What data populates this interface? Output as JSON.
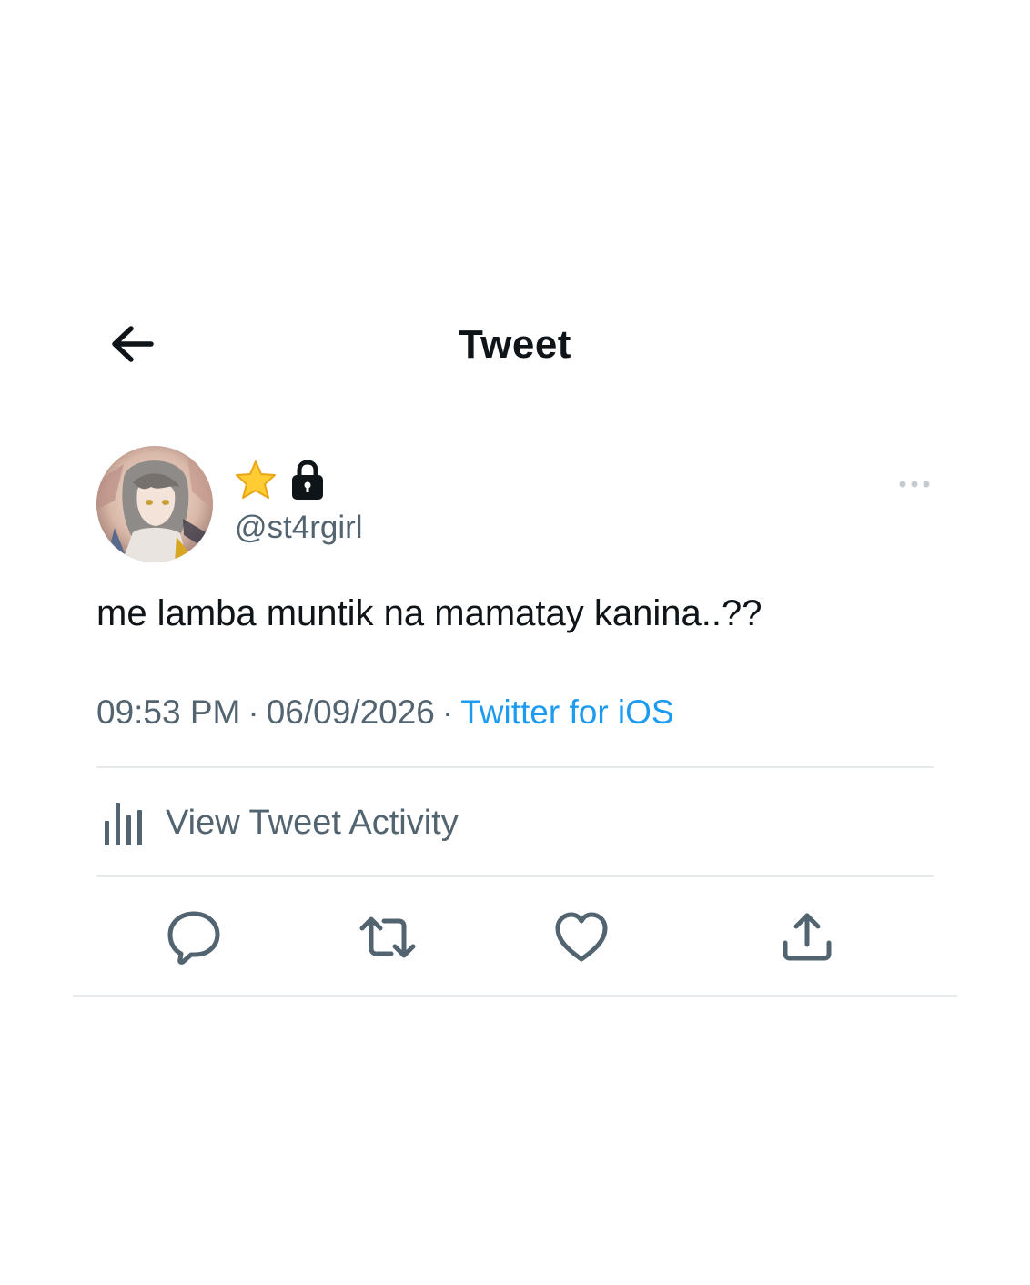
{
  "header": {
    "back_icon": "arrow-left-icon",
    "title": "Tweet"
  },
  "author": {
    "badges": [
      "star-emoji-icon",
      "lock-icon"
    ],
    "handle": "@st4rgirl",
    "avatar": "avatar-image"
  },
  "tweet": {
    "text": "me lamba muntik na mamatay kanina..??",
    "time": "09:53 PM",
    "date": "06/09/2026",
    "separator": "·",
    "source": "Twitter for iOS"
  },
  "activity": {
    "icon": "bar-chart-icon",
    "label": "View Tweet Activity"
  },
  "actions": {
    "reply_icon": "reply-icon",
    "retweet_icon": "retweet-icon",
    "like_icon": "heart-icon",
    "share_icon": "share-icon"
  },
  "colors": {
    "text_primary": "#0f1419",
    "text_secondary": "#536471",
    "link": "#1d9bf0",
    "divider": "#e7eaec",
    "star": "#ffcc33"
  }
}
